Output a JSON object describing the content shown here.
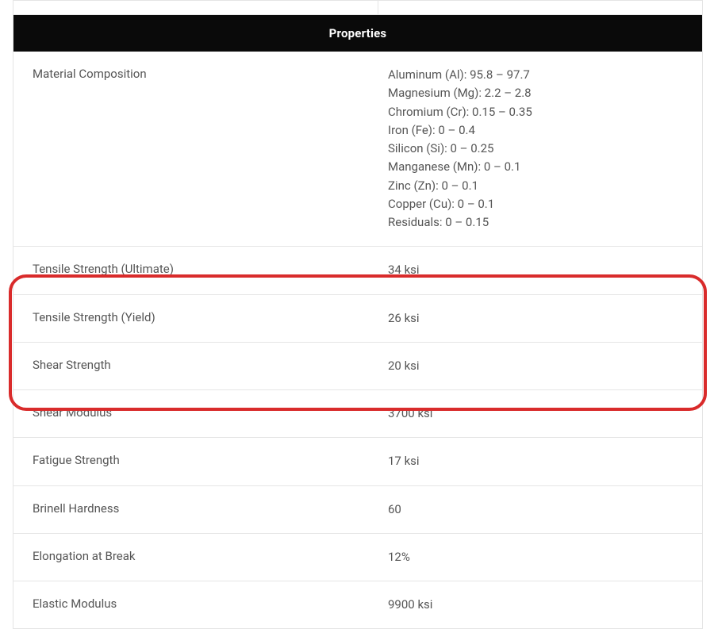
{
  "header": "Properties",
  "rows": [
    {
      "label": "Material Composition",
      "value": "Aluminum (Al): 95.8 – 97.7\nMagnesium (Mg): 2.2 – 2.8\nChromium (Cr): 0.15 – 0.35\nIron (Fe): 0 – 0.4\nSilicon (Si): 0 – 0.25\nManganese (Mn): 0 – 0.1\nZinc (Zn): 0 – 0.1\nCopper (Cu): 0 – 0.1\nResiduals: 0 – 0.15"
    },
    {
      "label": "Tensile Strength (Ultimate)",
      "value": "34 ksi"
    },
    {
      "label": "Tensile Strength (Yield)",
      "value": "26 ksi"
    },
    {
      "label": "Shear Strength",
      "value": "20 ksi"
    },
    {
      "label": "Shear Modulus",
      "value": "3700 ksi"
    },
    {
      "label": "Fatigue Strength",
      "value": "17 ksi"
    },
    {
      "label": "Brinell Hardness",
      "value": "60"
    },
    {
      "label": "Elongation at Break",
      "value": "12%"
    },
    {
      "label": "Elastic Modulus",
      "value": "9900 ksi"
    }
  ]
}
